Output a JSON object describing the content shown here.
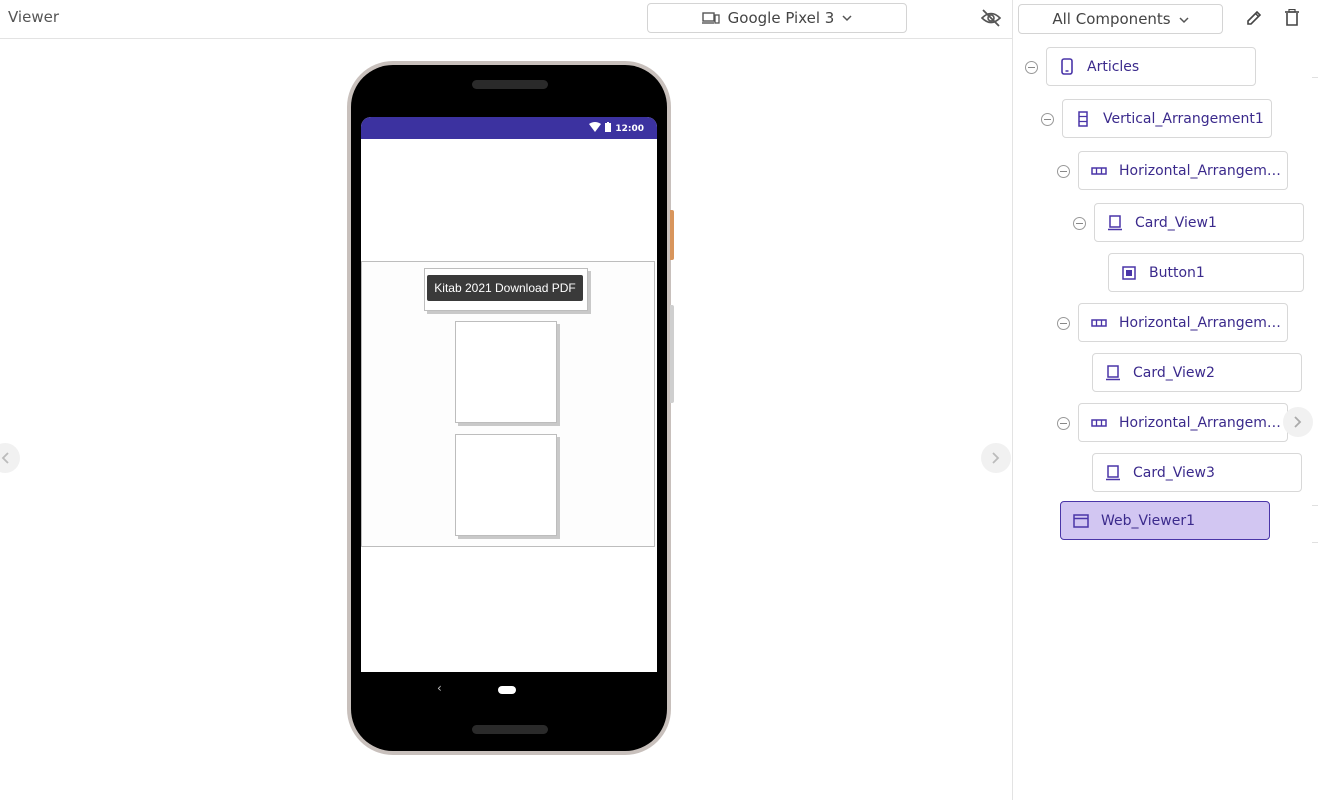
{
  "viewer": {
    "title": "Viewer",
    "device_label": "Google Pixel 3"
  },
  "phone": {
    "status_time": "12:00",
    "button1_text": "Kitab 2021 Download PDF"
  },
  "components": {
    "filter_label": "All Components",
    "tree": [
      {
        "label": "Articles",
        "icon": "phone-icon"
      },
      {
        "label": "Vertical_Arrangement1",
        "icon": "vertical-arrangement-icon"
      },
      {
        "label": "Horizontal_Arrangem…",
        "icon": "horizontal-arrangement-icon"
      },
      {
        "label": "Card_View1",
        "icon": "card-view-icon"
      },
      {
        "label": "Button1",
        "icon": "button-icon"
      },
      {
        "label": "Horizontal_Arrangem…",
        "icon": "horizontal-arrangement-icon"
      },
      {
        "label": "Card_View2",
        "icon": "card-view-icon"
      },
      {
        "label": "Horizontal_Arrangem…",
        "icon": "horizontal-arrangement-icon"
      },
      {
        "label": "Card_View3",
        "icon": "card-view-icon"
      },
      {
        "label": "Web_Viewer1",
        "icon": "web-viewer-icon"
      }
    ],
    "selected_item": "Web_Viewer1"
  },
  "colors": {
    "accent": "#3b2a8c",
    "selected_bg": "#d2c6f2",
    "status_bar": "#3c32a0"
  }
}
